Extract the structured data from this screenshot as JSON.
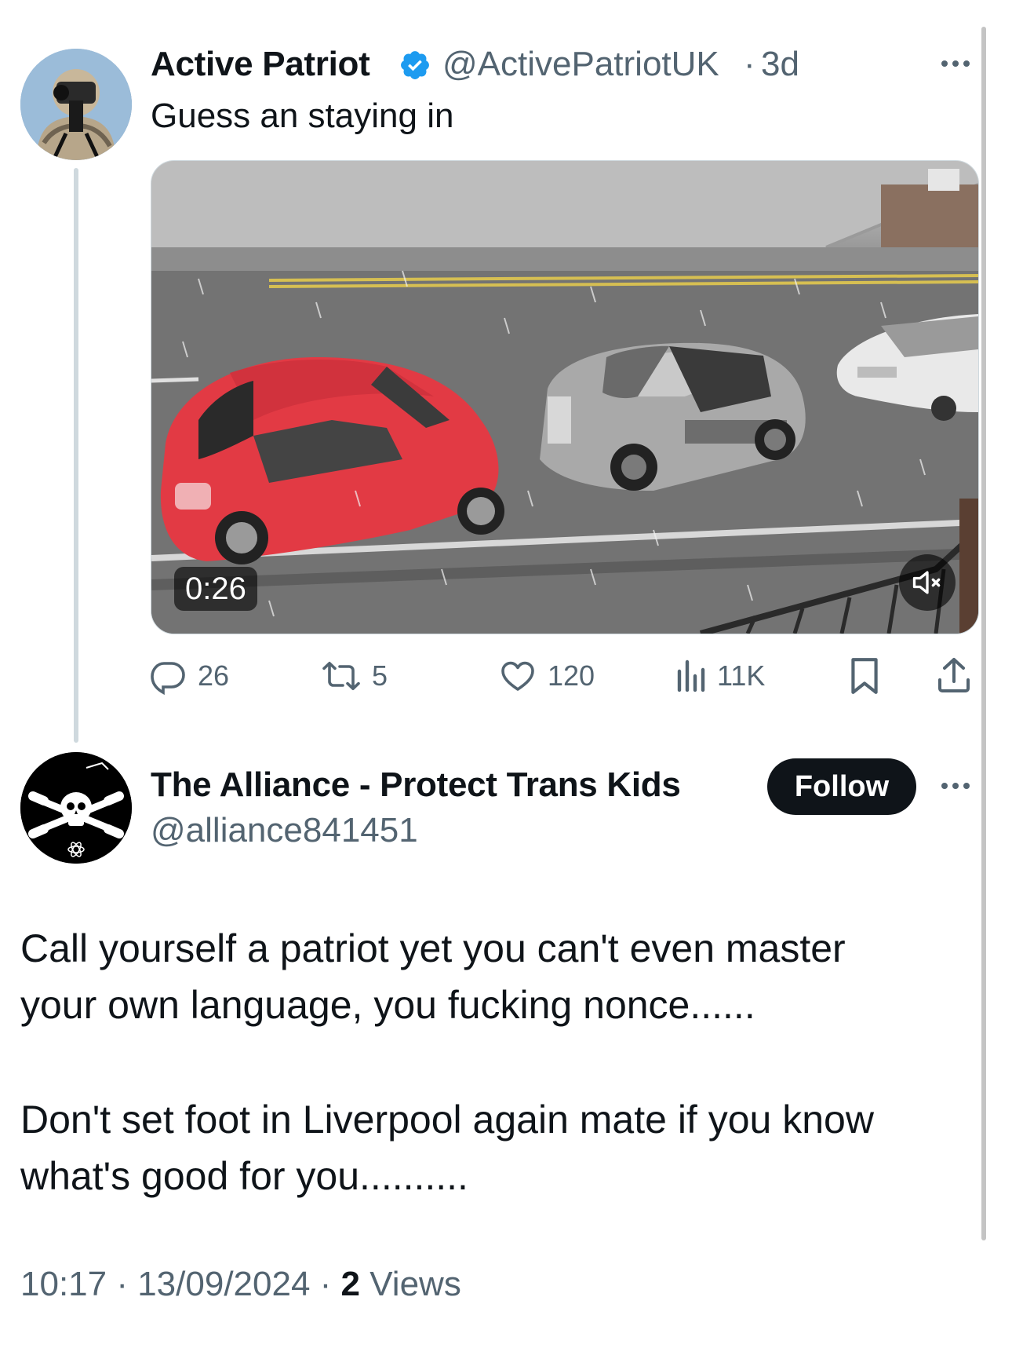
{
  "parent_tweet": {
    "display_name": "Active Patriot",
    "verified_icon": "verified-badge-icon",
    "handle": "@ActivePatriotUK",
    "separator": "·",
    "time_ago": "3d",
    "text": "Guess an staying in",
    "video": {
      "duration": "0:26"
    },
    "actions": {
      "replies": "26",
      "reposts": "5",
      "likes": "120",
      "views": "11K"
    }
  },
  "reply_tweet": {
    "display_name": "The Alliance - Protect Trans Kids",
    "handle": "@alliance841451",
    "follow_label": "Follow",
    "text_lines": [
      "Call yourself a patriot yet you can't even master",
      "your own language, you fucking nonce......",
      "Don't set foot in Liverpool again mate if you know",
      "what's good for you.........."
    ],
    "timestamp": "10:17 · 13/09/2024 · ",
    "views_count": "2",
    "views_label": " Views"
  },
  "colors": {
    "text_primary": "#0f1419",
    "text_secondary": "#536471",
    "verified_blue": "#1d9bf0",
    "thread_line": "#cfd9de"
  }
}
